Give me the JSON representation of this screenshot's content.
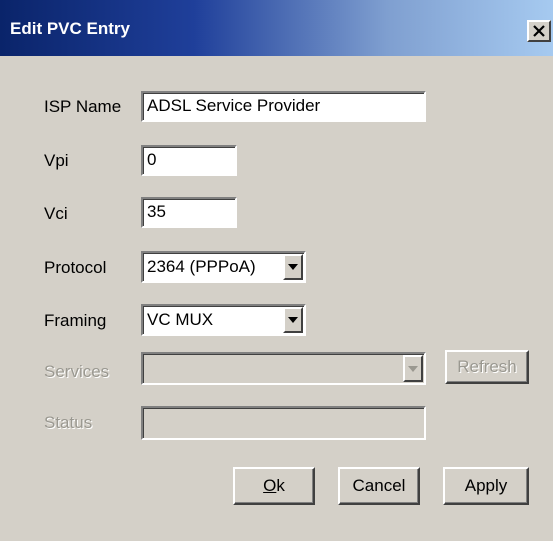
{
  "window": {
    "title": "Edit PVC Entry",
    "close_icon": "close-icon",
    "titlebar_color_start": "#0a246a",
    "titlebar_color_end": "#a6caf0",
    "face_color": "#d4d0c8"
  },
  "form": {
    "isp_name": {
      "label": "ISP Name",
      "value": "ADSL Service Provider"
    },
    "vpi": {
      "label": "Vpi",
      "value": "0"
    },
    "vci": {
      "label": "Vci",
      "value": "35"
    },
    "protocol": {
      "label": "Protocol",
      "selected": "2364 (PPPoA)"
    },
    "framing": {
      "label": "Framing",
      "selected": "VC MUX"
    },
    "services": {
      "label": "Services",
      "selected": "",
      "enabled": false
    },
    "status": {
      "label": "Status",
      "value": "",
      "enabled": false
    }
  },
  "buttons": {
    "refresh": {
      "label": "Refresh",
      "enabled": false
    },
    "ok": {
      "mnemonic": "O",
      "rest": "k"
    },
    "cancel": {
      "label": "Cancel"
    },
    "apply": {
      "label": "Apply"
    }
  }
}
